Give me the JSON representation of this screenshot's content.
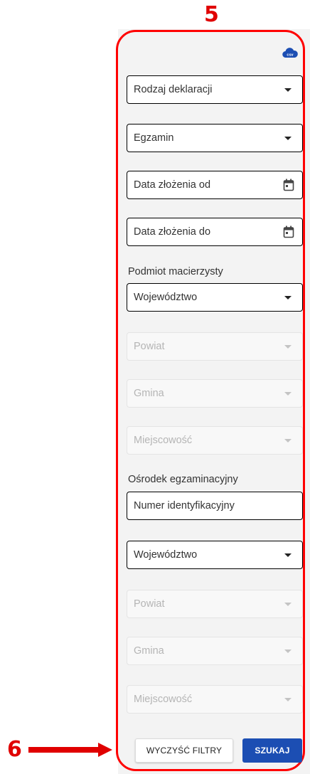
{
  "annotations": {
    "top_number": "5",
    "side_number": "6"
  },
  "colors": {
    "annotation": "#e00000",
    "primary_button": "#1c4eb3",
    "panel_bg": "#f3f3f3"
  },
  "export": {
    "icon": "csv-cloud-icon",
    "label": "csv"
  },
  "filters": {
    "declaration_type": "Rodzaj deklaracji",
    "exam": "Egzamin",
    "date_from": "Data złożenia od",
    "date_to": "Data złożenia do"
  },
  "parent_entity": {
    "heading": "Podmiot macierzysty",
    "voivodeship": "Województwo",
    "county": "Powiat",
    "commune": "Gmina",
    "locality": "Miejscowość"
  },
  "exam_center": {
    "heading": "Ośrodek egzaminacyjny",
    "id_number": "Numer identyfikacyjny",
    "voivodeship": "Województwo",
    "county": "Powiat",
    "commune": "Gmina",
    "locality": "Miejscowość"
  },
  "actions": {
    "clear_label": "WYCZYŚĆ FILTRY",
    "search_label": "SZUKAJ"
  }
}
